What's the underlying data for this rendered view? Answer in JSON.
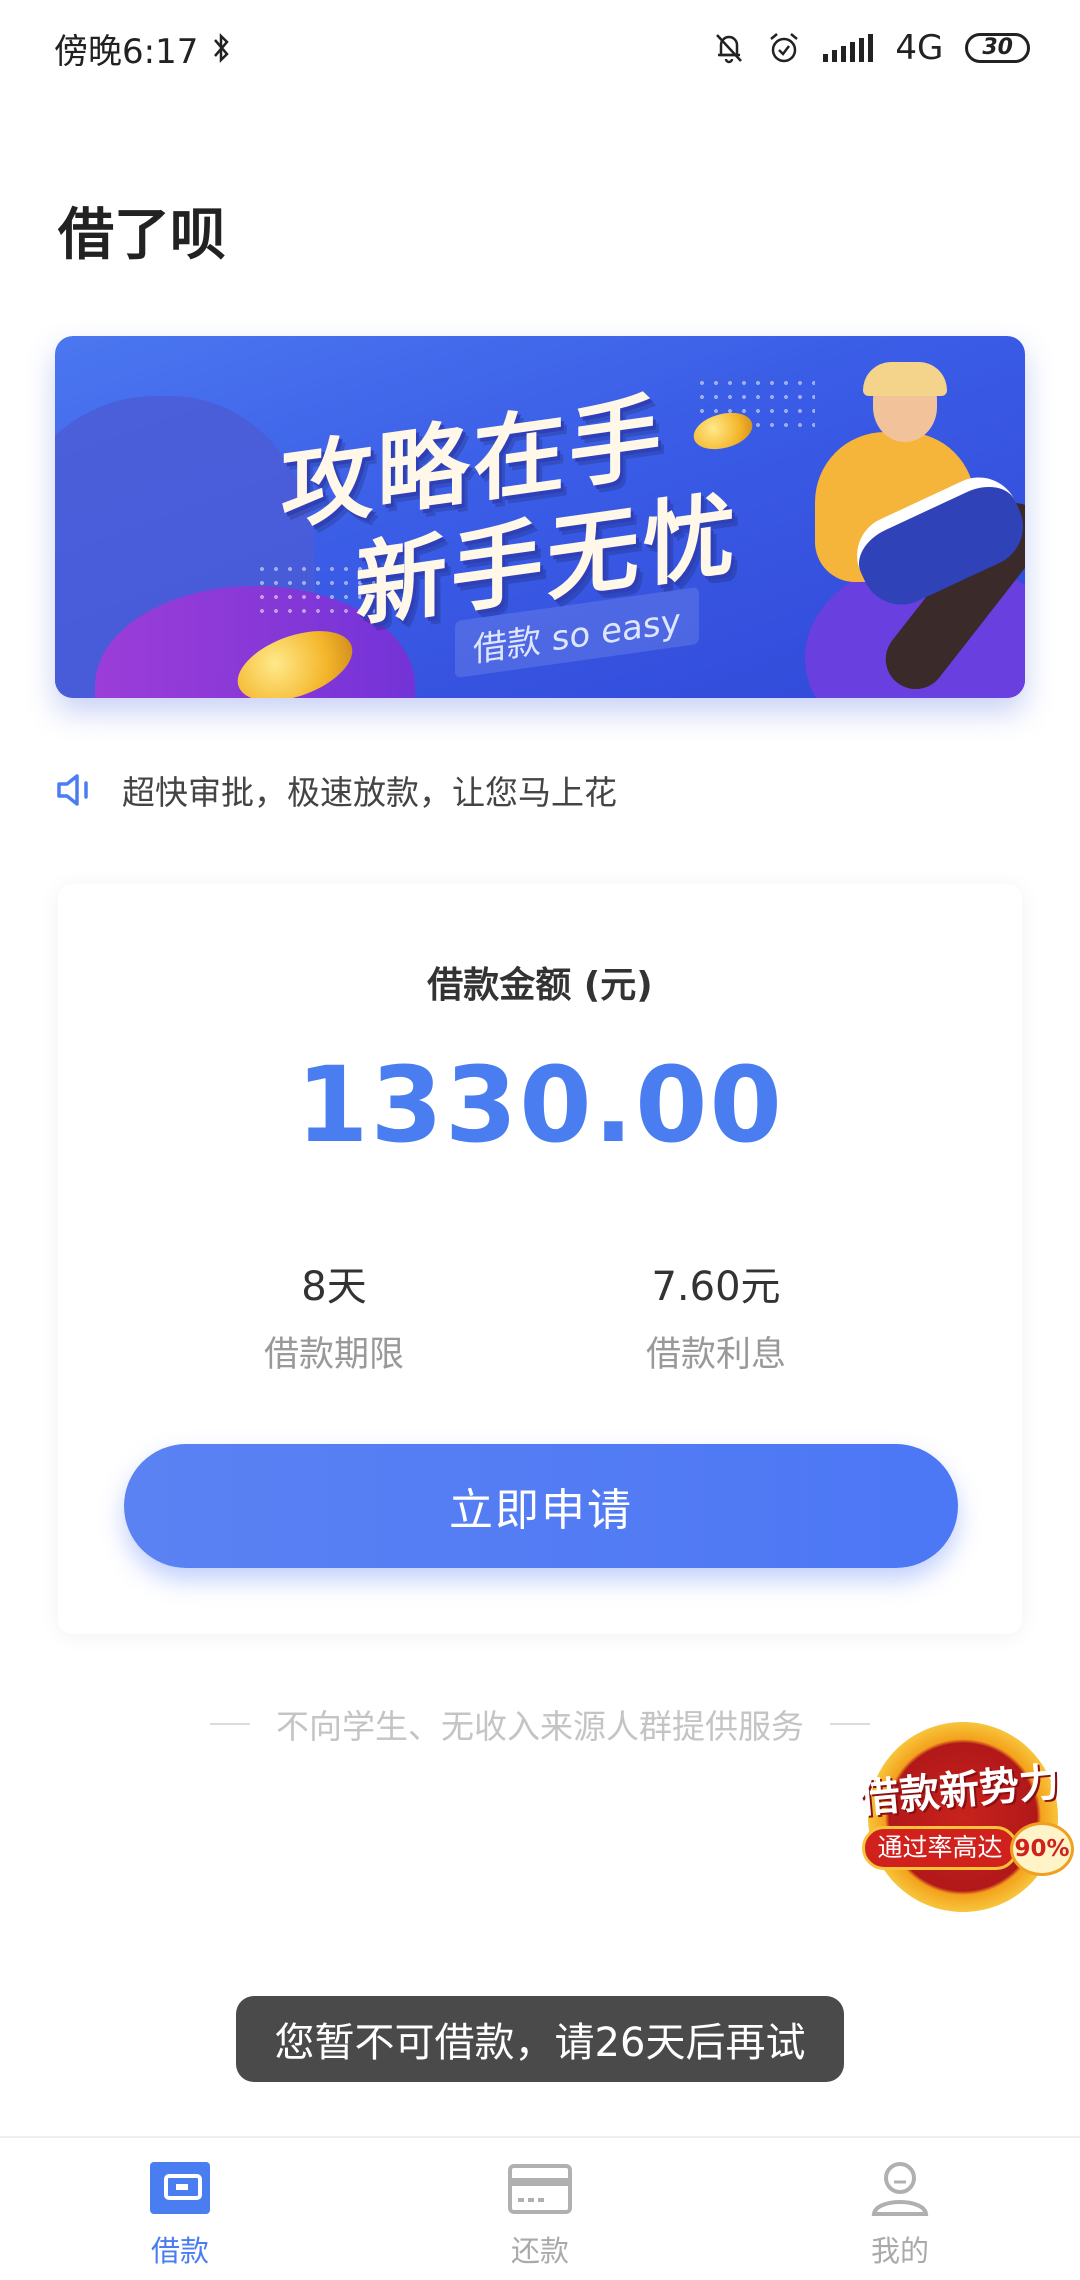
{
  "status_bar": {
    "time": "傍晚6:17",
    "network": "4G",
    "battery": "30"
  },
  "app": {
    "title": "借了呗"
  },
  "banner": {
    "line1": "攻略在手",
    "line2": "新手无忧",
    "subtitle": "借款 so easy"
  },
  "notice": {
    "icon": "speaker-icon",
    "text": "超快审批，极速放款，让您马上花"
  },
  "loan_card": {
    "label": "借款金额 (元)",
    "amount": "1330.00",
    "term_value": "8天",
    "term_label": "借款期限",
    "interest_value": "7.60元",
    "interest_label": "借款利息",
    "apply_button": "立即申请"
  },
  "disclaimer": "不向学生、无收入来源人群提供服务",
  "promo": {
    "title": "借款新势力",
    "subtitle": "通过率高达",
    "rate": "90%"
  },
  "toast": "您暂不可借款，请26天后再试",
  "tabs": [
    {
      "label": "借款",
      "icon": "wallet-icon",
      "active": true
    },
    {
      "label": "还款",
      "icon": "card-icon",
      "active": false
    },
    {
      "label": "我的",
      "icon": "user-icon",
      "active": false
    }
  ],
  "colors": {
    "accent": "#4a7ef0",
    "toast_bg": "#4a4a4a",
    "promo_red": "#d0211c"
  }
}
